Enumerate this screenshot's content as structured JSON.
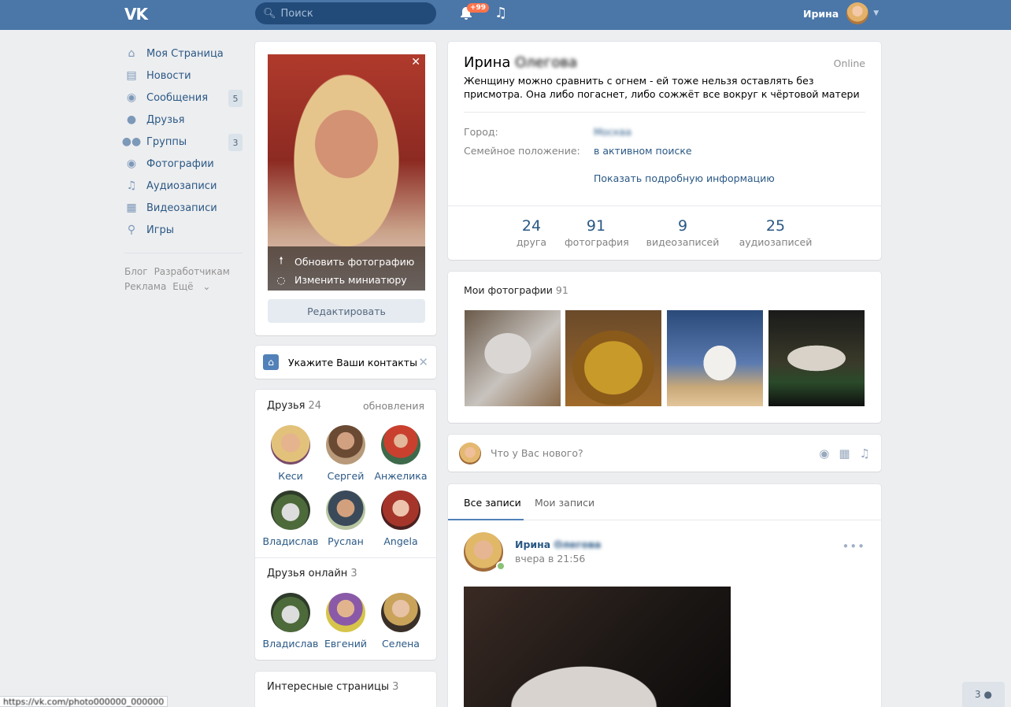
{
  "header": {
    "search_placeholder": "Поиск",
    "notif_badge": "+99",
    "user_name": "Ирина"
  },
  "nav": {
    "items": [
      {
        "label": "Моя Страница"
      },
      {
        "label": "Новости"
      },
      {
        "label": "Сообщения",
        "count": "5"
      },
      {
        "label": "Друзья"
      },
      {
        "label": "Группы",
        "count": "3"
      },
      {
        "label": "Фотографии"
      },
      {
        "label": "Аудиозаписи"
      },
      {
        "label": "Видеозаписи"
      },
      {
        "label": "Игры"
      }
    ],
    "footer": [
      "Блог",
      "Разработчикам",
      "Реклама",
      "Ещё"
    ]
  },
  "profile_photo": {
    "update": "Обновить фотографию",
    "thumbnail": "Изменить миниатюру",
    "edit": "Редактировать"
  },
  "contacts_prompt": "Укажите Ваши контакты",
  "friends": {
    "title": "Друзья",
    "count": "24",
    "updates": "обновления",
    "list": [
      {
        "name": "Кеси"
      },
      {
        "name": "Сергей"
      },
      {
        "name": "Анжелика"
      },
      {
        "name": "Владислав"
      },
      {
        "name": "Руслан"
      },
      {
        "name": "Angela"
      }
    ]
  },
  "friends_online": {
    "title": "Друзья онлайн",
    "count": "3",
    "list": [
      {
        "name": "Владислав"
      },
      {
        "name": "Евгений"
      },
      {
        "name": "Селена"
      }
    ]
  },
  "interesting": {
    "title": "Интересные страницы",
    "count": "3"
  },
  "profile": {
    "first_name": "Ирина",
    "last_name_blurred": "Олегова",
    "online": "Online",
    "status": "Женщину можно сравнить с огнем - ей тоже нельзя оставлять без присмотра. Она либо погаснет, либо сожжёт все вокруг к чёртовой матери",
    "city_label": "Город:",
    "city": "Москва",
    "family_label": "Семейное положение:",
    "family": "в активном поиске",
    "more": "Показать подробную информацию",
    "counters": [
      {
        "num": "24",
        "label": "друга"
      },
      {
        "num": "91",
        "label": "фотография"
      },
      {
        "num": "9",
        "label": "видеозаписей"
      },
      {
        "num": "25",
        "label": "аудиозаписей"
      }
    ]
  },
  "photos": {
    "title": "Мои фотографии",
    "count": "91"
  },
  "composer": {
    "placeholder": "Что у Вас нового?"
  },
  "wall": {
    "tab_all": "Все записи",
    "tab_mine": "Мои записи",
    "post_author": "Ирина",
    "post_author_blurred": "Олегова",
    "post_time": "вчера в 21:56"
  },
  "status_bar": {
    "url": "https://vk.com/photo000000_000000"
  },
  "chat_count": "3"
}
